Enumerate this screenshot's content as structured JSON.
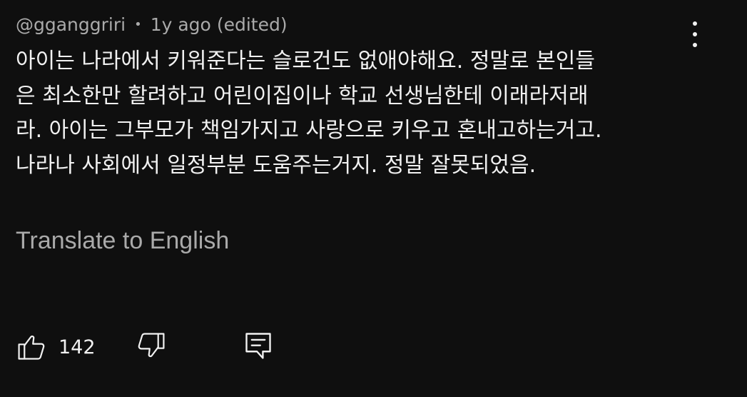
{
  "comment": {
    "author": "@gganggriri",
    "separator": "•",
    "time": "1y ago",
    "edited": "(edited)",
    "text_lines": [
      "아이는 나라에서 키워준다는 슬로건도 없애야해요. 정말로 본인들",
      "은 최소한만 할려하고 어린이집이나 학교 선생님한테 이래라저래",
      "라. 아이는 그부모가 책임가지고 사랑으로 키우고 혼내고하는거고.",
      "나라나 사회에서 일정부분 도움주는거지. 정말 잘못되었음."
    ],
    "translate_label": "Translate to English",
    "like_count": "142"
  },
  "icons": {
    "more": "more-vertical-icon",
    "like": "thumbs-up-icon",
    "dislike": "thumbs-down-icon",
    "reply": "reply-comment-icon"
  },
  "colors": {
    "background": "#0f0f0f",
    "primary_text": "#f1f1f1",
    "secondary_text": "#aaaaaa"
  }
}
